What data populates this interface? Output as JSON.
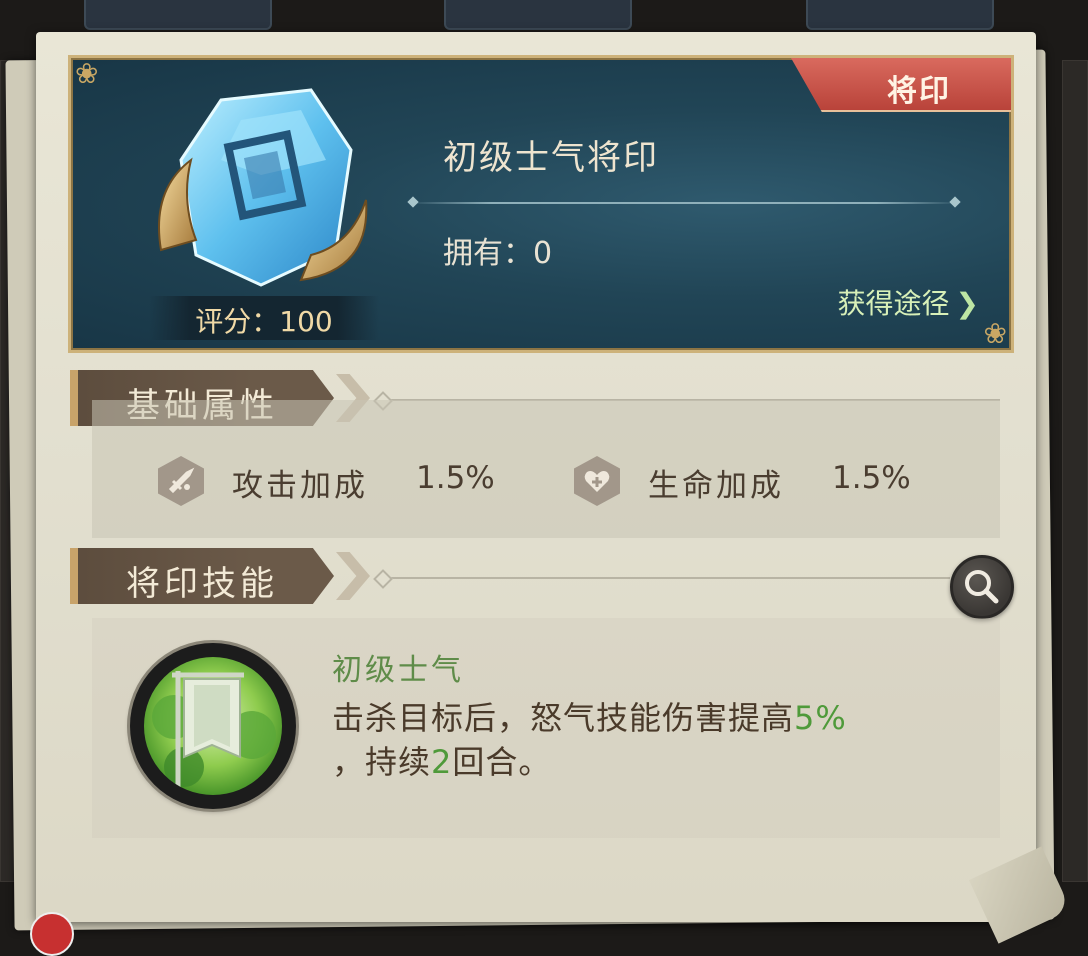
{
  "card": {
    "tag": "将印",
    "title": "初级士气将印",
    "own": "拥有：0",
    "score": "评分：100",
    "source_link": "获得途径"
  },
  "basic_section": {
    "title": "基础属性",
    "attributes": [
      {
        "name": "攻击加成",
        "value": "1.5%",
        "icon": "attack-icon"
      },
      {
        "name": "生命加成",
        "value": "1.5%",
        "icon": "health-icon"
      }
    ]
  },
  "skill_section": {
    "title": "将印技能",
    "skill_name": "初级士气",
    "desc_part1": "击杀目标后，怒气技能伤害提高",
    "desc_hl1": "5%",
    "desc_part2": "，持续",
    "desc_hl2": "2",
    "desc_part3": "回合。",
    "icon": "banner-icon"
  },
  "colors": {
    "card_bg": "#214556",
    "tag_red": "#c2483e",
    "skill_green": "#5f8c49",
    "highlight_green": "#4f9a3a",
    "section_brown": "#6b5a49"
  }
}
